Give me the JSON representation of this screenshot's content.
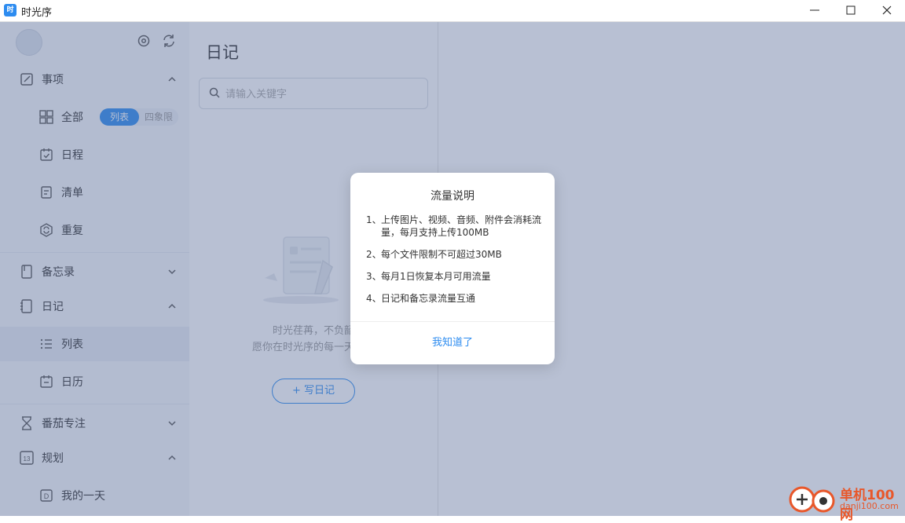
{
  "window": {
    "title": "时光序",
    "app_icon": "app-logo-icon"
  },
  "sidebar": {
    "top_icons": [
      "settings-icon",
      "sync-icon"
    ],
    "sections": [
      {
        "label": "事项",
        "icon": "edit-square-icon",
        "expanded": true,
        "items": [
          {
            "label": "全部",
            "icon": "grid-icon"
          },
          {
            "label": "日程",
            "icon": "calendar-check-icon"
          },
          {
            "label": "清单",
            "icon": "list-doc-icon"
          },
          {
            "label": "重复",
            "icon": "repeat-shield-icon"
          }
        ]
      },
      {
        "label": "备忘录",
        "icon": "notebook-icon",
        "expanded": false
      },
      {
        "label": "日记",
        "icon": "diary-icon",
        "expanded": true,
        "items": [
          {
            "label": "列表",
            "icon": "list-icon",
            "active": true
          },
          {
            "label": "日历",
            "icon": "calendar-icon"
          }
        ]
      },
      {
        "label": "番茄专注",
        "icon": "hourglass-icon",
        "expanded": false
      },
      {
        "label": "规划",
        "icon": "calendar-13-icon",
        "expanded": true,
        "items": [
          {
            "label": "我的一天",
            "icon": "day-d-icon"
          }
        ]
      }
    ],
    "view_toggle": {
      "active": "列表",
      "inactive": "四象限"
    },
    "planning_icon_text": "13",
    "day_icon_text": "D"
  },
  "middle": {
    "title": "日记",
    "search_placeholder": "请输入关键字",
    "empty_line1": "时光荏苒，不负韶",
    "empty_line2": "愿你在时光序的每一天，都",
    "write_button": "+ 写日记"
  },
  "modal": {
    "title": "流量说明",
    "rules": [
      {
        "num": "1、",
        "text": "上传图片、视频、音频、附件会消耗流量，每月支持上传100MB"
      },
      {
        "num": "2、",
        "text": "每个文件限制不可超过30MB"
      },
      {
        "num": "3、",
        "text": "每月1日恢复本月可用流量"
      },
      {
        "num": "4、",
        "text": "日记和备忘录流量互通"
      }
    ],
    "confirm_button": "我知道了"
  },
  "watermark": {
    "text": "单机100网",
    "sub": "danji100.com"
  },
  "colors": {
    "accent": "#2d8cf0",
    "overlay": "rgba(86,106,150,0.42)"
  }
}
